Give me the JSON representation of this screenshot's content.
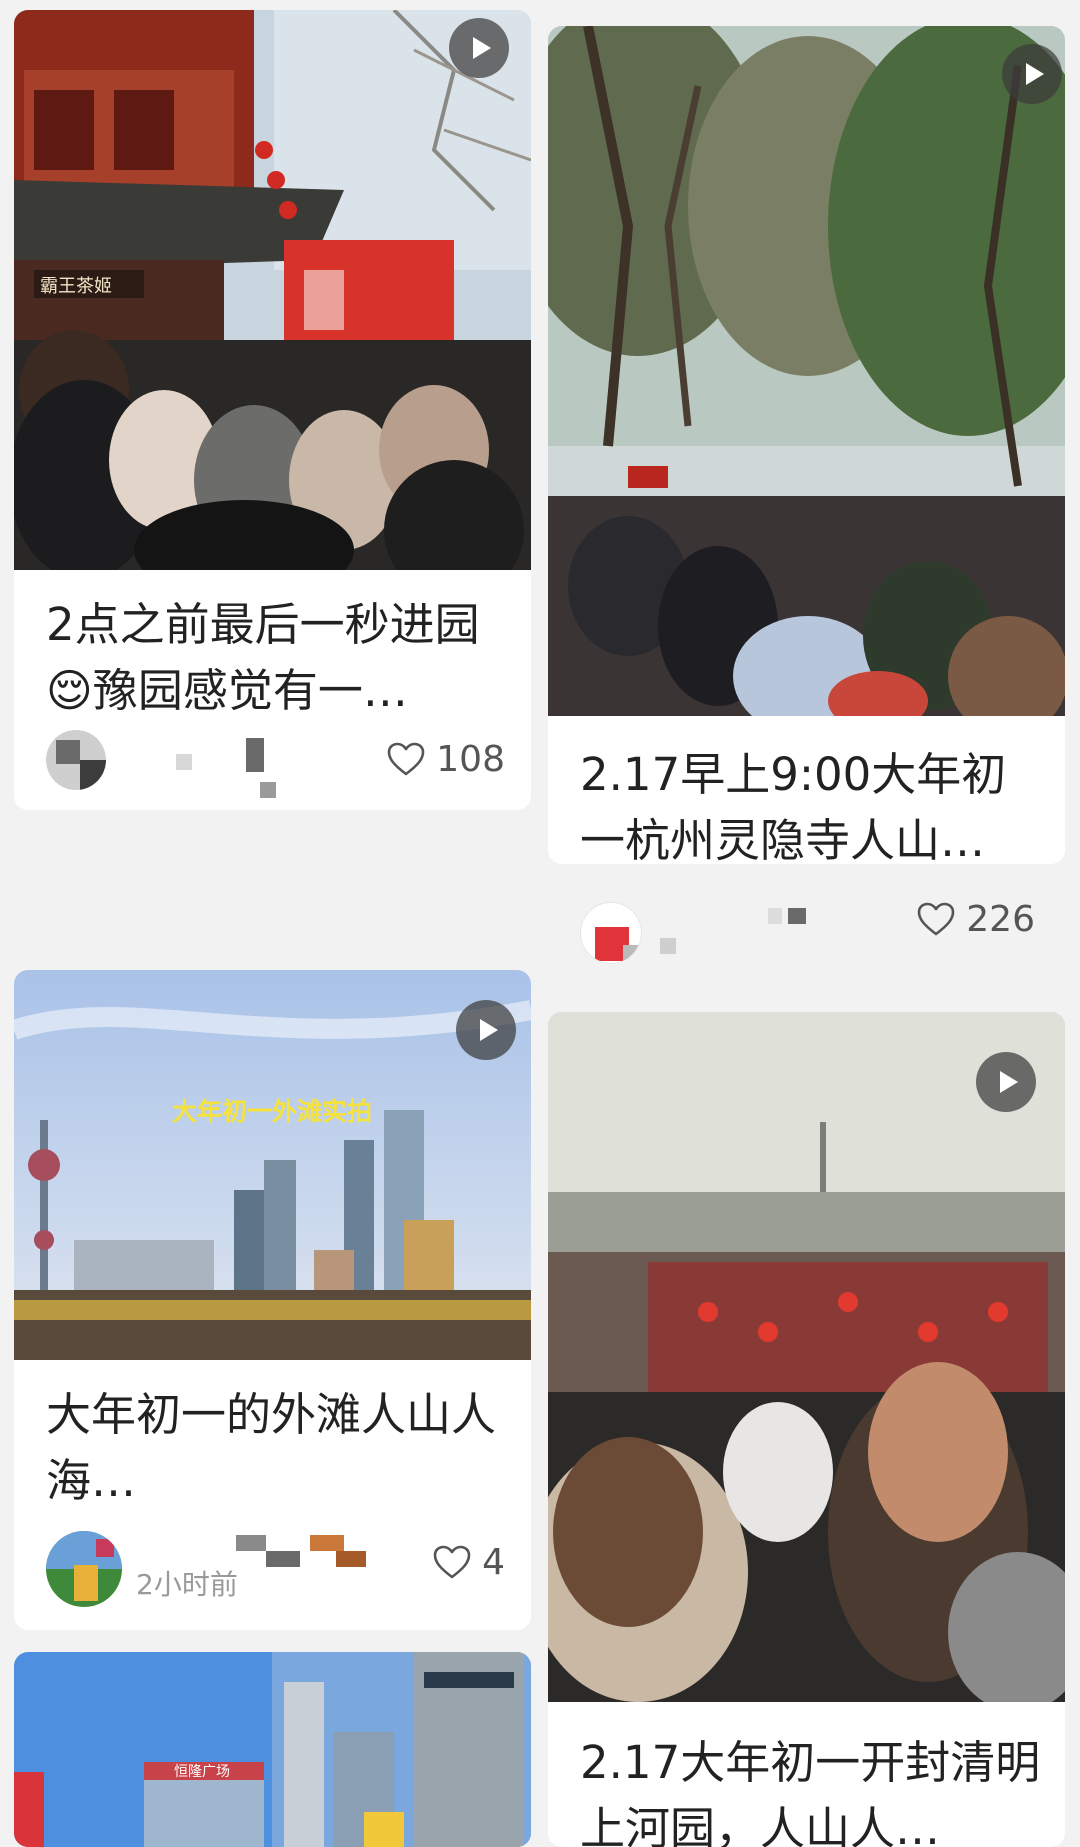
{
  "feed": {
    "cards": [
      {
        "title": "2点之前最后一秒进园😌豫园感觉有一…",
        "likes": "108",
        "time": "",
        "has_video": true,
        "thumb_sign": "霸王茶姬"
      },
      {
        "title": "2.17早上9:00大年初一杭州灵隐寺人山…",
        "likes": "226",
        "time": "",
        "has_video": false
      },
      {
        "title": "大年初一的外滩人山人海…",
        "likes": "4",
        "time": "2小时前",
        "has_video": true,
        "thumb_caption": "大年初一外滩实拍"
      },
      {
        "title": "2.17大年初一开封清明上河园，人山人…",
        "likes": "",
        "time": "",
        "has_video": true
      },
      {
        "title": "",
        "likes": "",
        "time": "",
        "has_video": false,
        "thumb_sign": "恒隆广场"
      }
    ]
  },
  "icons": {
    "play": "play-icon",
    "like": "heart-outline-icon"
  },
  "colors": {
    "background": "#f2f2f2",
    "card": "#ffffff",
    "title_text": "#222222",
    "meta_text": "#9a9a9a",
    "caption_yellow": "#f5e23c"
  }
}
